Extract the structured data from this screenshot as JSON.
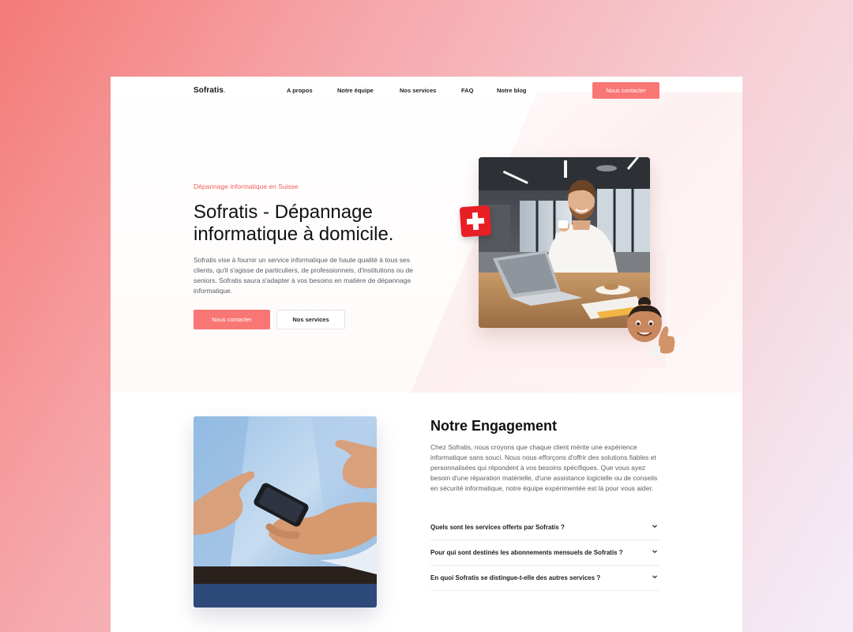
{
  "brand": {
    "name": "Sofratis",
    "dot": ".",
    "accent": "#f87775"
  },
  "nav": {
    "links": [
      "A propos",
      "Notre équipe",
      "Nos services",
      "FAQ",
      "Notre blog"
    ],
    "cta": "Nous contacter"
  },
  "hero": {
    "kicker": "Dépannage informatique en Suisse",
    "title": "Sofratis - Dépannage informatique à domicile.",
    "lead": "Sofratis vise à fournir un service informatique de haute qualité à tous ses clients, qu'il s'agisse de particuliers, de professionnels, d'institutions ou de seniors. Sofratis saura s'adapter à vos besoins en matière de dépannage informatique.",
    "primary_button": "Nous contacter",
    "secondary_button": "Nos services"
  },
  "engagement": {
    "title": "Notre Engagement",
    "body": "Chez Sofratis, nous croyons que chaque client mérite une expérience informatique sans souci. Nous nous efforçons d'offrir des solutions fiables et personnalisées qui répondent à vos besoins spécifiques. Que vous ayez besoin d'une réparation matérielle, d'une assistance logicielle ou de conseils en sécurité informatique, notre équipe expérimentée est là pour vous aider.",
    "faq": [
      "Quels sont les services offerts par Sofratis ?",
      "Pour qui sont destinés les abonnements mensuels de Sofratis ?",
      "En quoi Sofratis se distingue-t-elle des autres services ?"
    ]
  },
  "icons": {
    "flag": "swiss-flag-icon",
    "chevron": "chevron-down-icon",
    "memoji": "thumbs-up-memoji-icon"
  }
}
